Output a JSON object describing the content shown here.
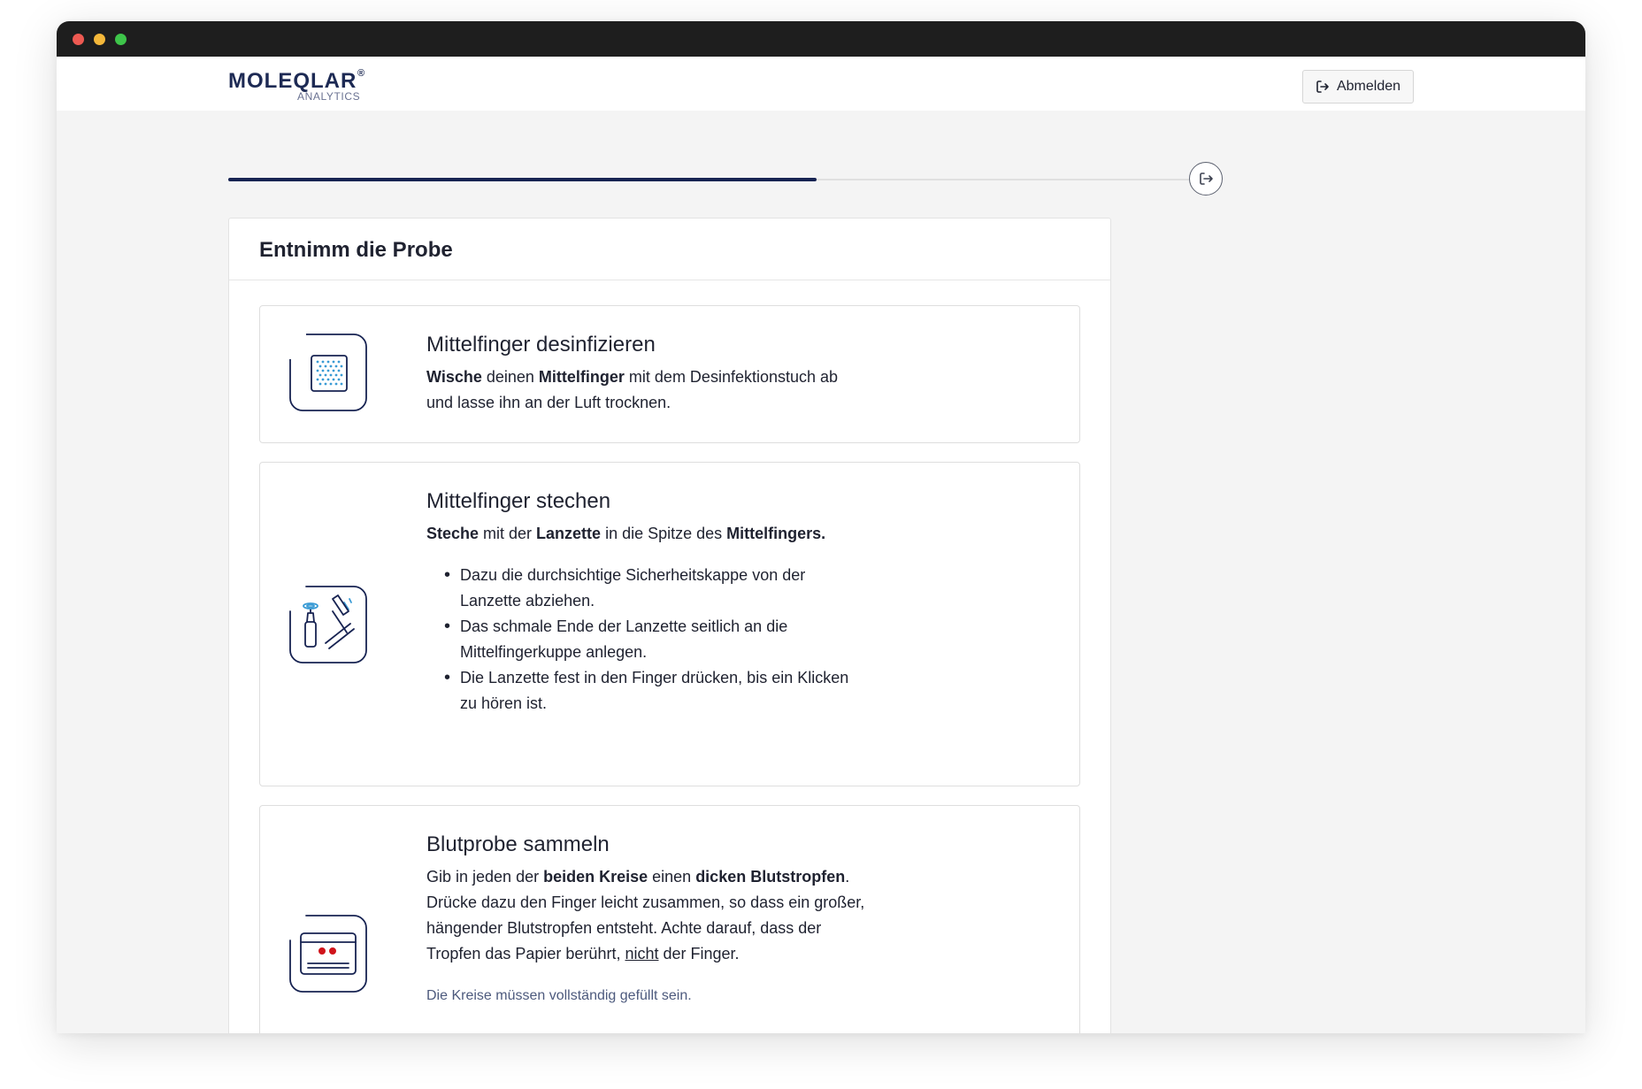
{
  "brand": {
    "name": "MOLEQLAR",
    "registered": "®",
    "subtitle": "ANALYTICS"
  },
  "header": {
    "logout_label": "Abmelden"
  },
  "progress": {
    "fraction": 0.61
  },
  "card": {
    "title": "Entnimm die Probe"
  },
  "steps": [
    {
      "title": "Mittelfinger desinfizieren",
      "text": [
        {
          "t": "Wische",
          "b": true
        },
        {
          "t": " deinen "
        },
        {
          "t": "Mittelfinger",
          "b": true
        },
        {
          "t": " mit dem Desinfektionstuch ab und lasse ihn an der Luft trocknen."
        }
      ]
    },
    {
      "title": "Mittelfinger stechen",
      "text": [
        {
          "t": "Steche",
          "b": true
        },
        {
          "t": " mit der "
        },
        {
          "t": "Lanzette",
          "b": true
        },
        {
          "t": " in die Spitze des "
        },
        {
          "t": "Mittelfingers.",
          "b": true
        }
      ],
      "list": [
        "Dazu die durchsichtige Sicherheitskappe von der Lanzette abziehen.",
        "Das schmale Ende der Lanzette seitlich an die Mittelfingerkuppe anlegen.",
        "Die Lanzette fest in den Finger drücken, bis ein Klicken zu hören ist."
      ]
    },
    {
      "title": "Blutprobe sammeln",
      "text": [
        {
          "t": "Gib in jeden der "
        },
        {
          "t": "beiden Kreise",
          "b": true
        },
        {
          "t": " einen "
        },
        {
          "t": "dicken Blutstropfen",
          "b": true
        },
        {
          "t": ". Drücke dazu den Finger leicht zusammen, so dass ein großer, hängender Blutstropfen entsteht. Achte darauf, dass der Tropfen das Papier berührt, "
        },
        {
          "t": "nicht",
          "u": true
        },
        {
          "t": " der Finger."
        }
      ],
      "note": "Die Kreise müssen vollständig gefüllt sein."
    }
  ],
  "colors": {
    "primary": "#172352",
    "accent_blue": "#3a9bd5",
    "blood_red": "#d0141b"
  }
}
